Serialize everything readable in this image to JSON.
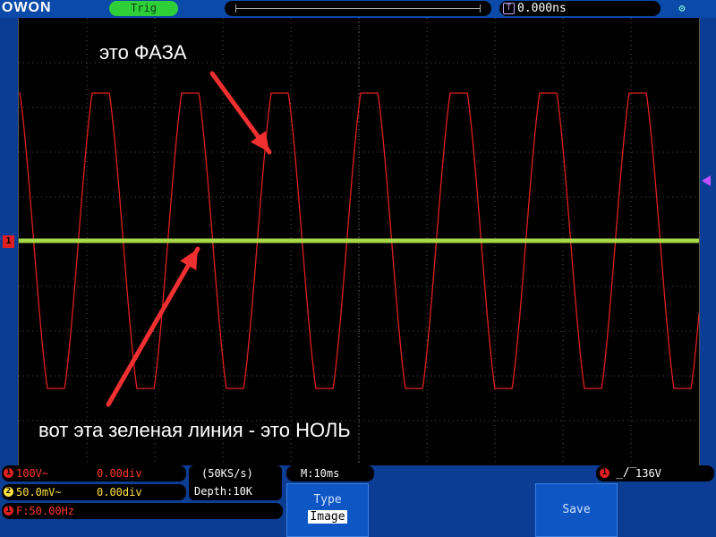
{
  "header": {
    "brand": "OWON",
    "trigger_status": "Trig",
    "horizontal_position": "0.000ns",
    "trigger_marker_label": "T"
  },
  "annotations": {
    "phase_label": "это  ФАЗА",
    "zero_label": "вот эта зеленая линия - это НОЛЬ"
  },
  "waveform": {
    "ch1_color": "#e02020",
    "ch2_color": "#a8d84a",
    "ch1_frequency_hz": 50,
    "timebase_ms_per_div": 10,
    "cycles_visible": 7.6
  },
  "channels": {
    "ch1": {
      "number": "1",
      "scale": "100V~",
      "offset": "0.00div"
    },
    "ch2": {
      "number": "2",
      "scale": "50.0mV~",
      "offset": "0.00div"
    },
    "freq": {
      "number": "1",
      "label": "F:50.00Hz"
    }
  },
  "acquisition": {
    "sample_rate": "(50KS/s)",
    "depth": "Depth:10K"
  },
  "timebase": {
    "label": "M:10ms"
  },
  "trigger": {
    "source": "1",
    "level": "136V",
    "slope_icon": "rising-edge"
  },
  "softkeys": {
    "type_title": "Type",
    "type_value": "Image",
    "save_label": "Save"
  },
  "markers": {
    "ch1_ground": "1"
  }
}
